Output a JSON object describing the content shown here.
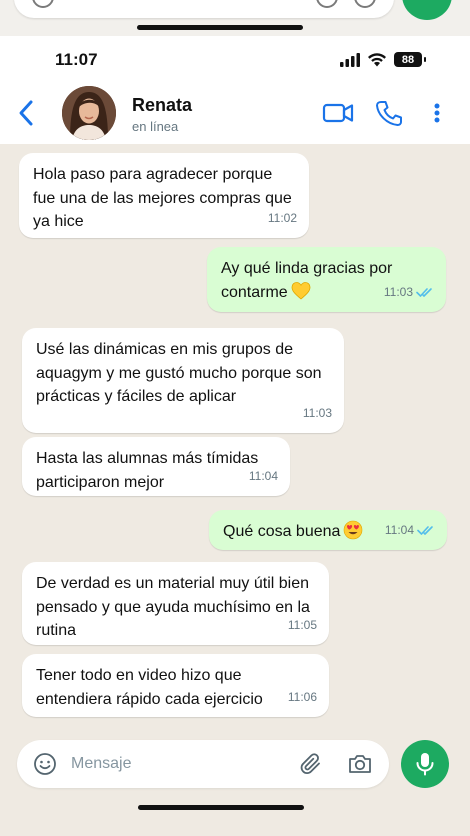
{
  "status_bar": {
    "time": "11:07",
    "battery": "88"
  },
  "contact": {
    "name": "Renata",
    "status": "en línea"
  },
  "messages": [
    {
      "dir": "in",
      "text": "Hola paso para agradecer porque fue una de las mejores compras que ya hice",
      "time": "11:02"
    },
    {
      "dir": "out",
      "text": "Ay qué linda gracias por contarme",
      "emoji": "yellow-heart",
      "time": "11:03",
      "read": true
    },
    {
      "dir": "in",
      "text": "Usé las dinámicas en mis grupos de aquagym y me gustó mucho porque son prácticas y fáciles de aplicar",
      "time": "11:03"
    },
    {
      "dir": "in",
      "text": "Hasta las alumnas más tímidas participaron mejor",
      "time": "11:04"
    },
    {
      "dir": "out",
      "text": "Qué cosa buena",
      "emoji": "heart-eyes",
      "time": "11:04",
      "read": true
    },
    {
      "dir": "in",
      "text": "De verdad es un material muy útil bien pensado y que ayuda muchísimo en la rutina",
      "time": "11:05"
    },
    {
      "dir": "in",
      "text": "Tener todo en video hizo que entendiera rápido cada ejercicio",
      "time": "11:06"
    }
  ],
  "input": {
    "placeholder": "Mensaje",
    "value": ""
  },
  "colors": {
    "accent": "#1daa61",
    "outgoing_bubble": "#d9fdd3",
    "chat_bg": "#efeae2",
    "link_blue": "#1a73e8"
  },
  "icons": [
    "back-arrow-icon",
    "video-call-icon",
    "phone-icon",
    "more-vert-icon",
    "emoji-icon",
    "attach-icon",
    "camera-icon",
    "mic-icon",
    "double-check-icon"
  ]
}
